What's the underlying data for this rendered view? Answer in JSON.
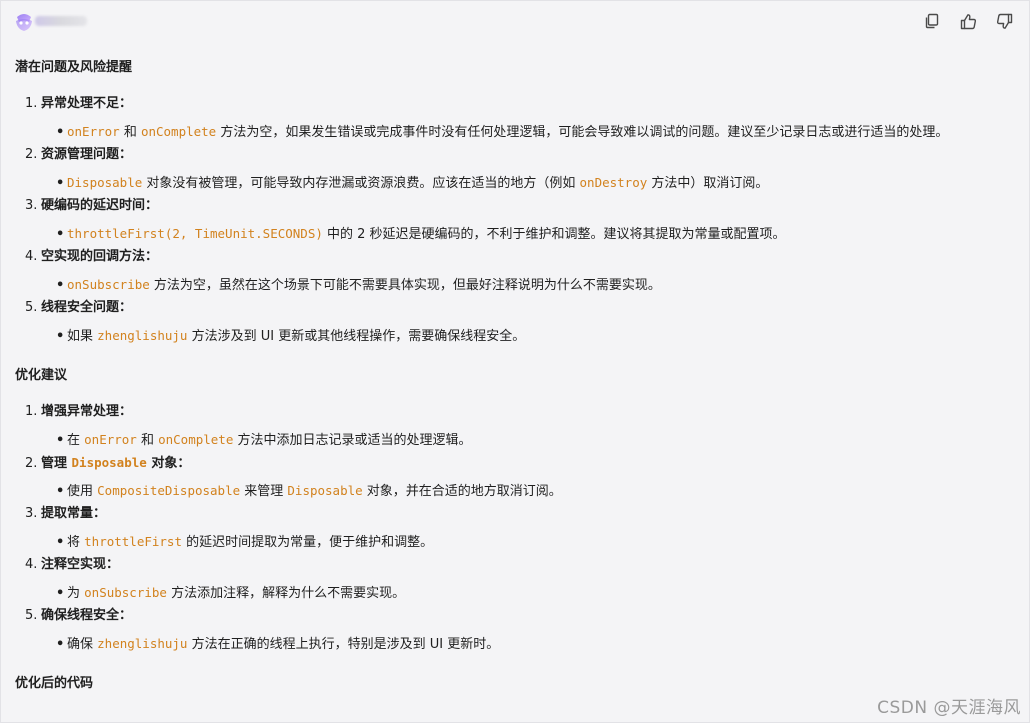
{
  "header": {
    "actions": [
      {
        "icon": "copy-icon"
      },
      {
        "icon": "thumbs-up-icon"
      },
      {
        "icon": "thumbs-down-icon"
      }
    ]
  },
  "sections": {
    "risks_title": "潜在问题及风险提醒",
    "optimize_title": "优化建议",
    "code_title": "优化后的代码"
  },
  "risks": [
    {
      "num": "1.",
      "title": "异常处理不足：",
      "bullet": [
        {
          "c": "onError"
        },
        {
          "t": " 和 "
        },
        {
          "c": "onComplete"
        },
        {
          "t": " 方法为空，如果发生错误或完成事件时没有任何处理逻辑，可能会导致难以调试的问题。建议至少记录日志或进行适当的处理。"
        }
      ]
    },
    {
      "num": "2.",
      "title": "资源管理问题：",
      "bullet": [
        {
          "c": "Disposable"
        },
        {
          "t": " 对象没有被管理，可能导致内存泄漏或资源浪费。应该在适当的地方（例如 "
        },
        {
          "c": "onDestroy"
        },
        {
          "t": " 方法中）取消订阅。"
        }
      ]
    },
    {
      "num": "3.",
      "title": "硬编码的延迟时间：",
      "bullet": [
        {
          "c": "throttleFirst(2, TimeUnit.SECONDS)"
        },
        {
          "t": " 中的 2 秒延迟是硬编码的，不利于维护和调整。建议将其提取为常量或配置项。"
        }
      ]
    },
    {
      "num": "4.",
      "title": "空实现的回调方法：",
      "bullet": [
        {
          "c": "onSubscribe"
        },
        {
          "t": " 方法为空，虽然在这个场景下可能不需要具体实现，但最好注释说明为什么不需要实现。"
        }
      ]
    },
    {
      "num": "5.",
      "title": "线程安全问题：",
      "bullet": [
        {
          "t": "如果 "
        },
        {
          "c": "zhenglishuju"
        },
        {
          "t": " 方法涉及到 UI 更新或其他线程操作，需要确保线程安全。"
        }
      ]
    }
  ],
  "optimizations": [
    {
      "num": "1.",
      "title": [
        {
          "t": "增强异常处理："
        }
      ],
      "bullet": [
        {
          "t": "在 "
        },
        {
          "c": "onError"
        },
        {
          "t": " 和 "
        },
        {
          "c": "onComplete"
        },
        {
          "t": " 方法中添加日志记录或适当的处理逻辑。"
        }
      ]
    },
    {
      "num": "2.",
      "title": [
        {
          "t": "管理 "
        },
        {
          "c": "Disposable"
        },
        {
          "t": " 对象："
        }
      ],
      "bullet": [
        {
          "t": "使用 "
        },
        {
          "c": "CompositeDisposable"
        },
        {
          "t": " 来管理 "
        },
        {
          "c": "Disposable"
        },
        {
          "t": " 对象，并在合适的地方取消订阅。"
        }
      ]
    },
    {
      "num": "3.",
      "title": [
        {
          "t": "提取常量："
        }
      ],
      "bullet": [
        {
          "t": "将 "
        },
        {
          "c": "throttleFirst"
        },
        {
          "t": " 的延迟时间提取为常量，便于维护和调整。"
        }
      ]
    },
    {
      "num": "4.",
      "title": [
        {
          "t": "注释空实现："
        }
      ],
      "bullet": [
        {
          "t": "为 "
        },
        {
          "c": "onSubscribe"
        },
        {
          "t": " 方法添加注释，解释为什么不需要实现。"
        }
      ]
    },
    {
      "num": "5.",
      "title": [
        {
          "t": "确保线程安全："
        }
      ],
      "bullet": [
        {
          "t": "确保 "
        },
        {
          "c": "zhenglishuju"
        },
        {
          "t": " 方法在正确的线程上执行，特别是涉及到 UI 更新时。"
        }
      ]
    }
  ],
  "watermark": "CSDN @天涯海风",
  "colors": {
    "code": "#d2821e",
    "background": "#f4f4f6",
    "text": "#1f1f1f"
  }
}
